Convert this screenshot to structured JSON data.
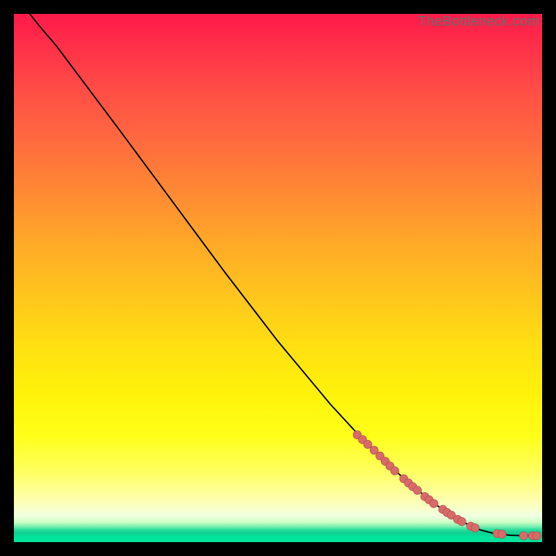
{
  "watermark": "TheBottleneck.com",
  "colors": {
    "background": "#000000",
    "dot_fill": "#d86a6a",
    "dot_stroke": "#a64646",
    "line": "#000000"
  },
  "chart_data": {
    "type": "line",
    "title": "",
    "xlabel": "",
    "ylabel": "",
    "xlim": [
      0,
      100
    ],
    "ylim": [
      0,
      100
    ],
    "note": "Axes unlabeled; values are percent of plot width/height read from pixels. y=100 at top, y=0 at bottom.",
    "line_points": [
      {
        "x": 3.0,
        "y": 100.0
      },
      {
        "x": 5.0,
        "y": 97.5
      },
      {
        "x": 8.0,
        "y": 94.0
      },
      {
        "x": 11.0,
        "y": 90.0
      },
      {
        "x": 20.0,
        "y": 78.0
      },
      {
        "x": 30.0,
        "y": 64.5
      },
      {
        "x": 40.0,
        "y": 51.0
      },
      {
        "x": 50.0,
        "y": 38.0
      },
      {
        "x": 60.0,
        "y": 26.0
      },
      {
        "x": 66.0,
        "y": 19.5
      },
      {
        "x": 70.0,
        "y": 15.5
      },
      {
        "x": 75.0,
        "y": 11.0
      },
      {
        "x": 80.0,
        "y": 7.0
      },
      {
        "x": 85.0,
        "y": 3.8
      },
      {
        "x": 88.0,
        "y": 2.4
      },
      {
        "x": 91.0,
        "y": 1.6
      },
      {
        "x": 94.0,
        "y": 1.3
      },
      {
        "x": 97.0,
        "y": 1.2
      },
      {
        "x": 99.0,
        "y": 1.2
      }
    ],
    "scatter_points": [
      {
        "x": 65.0,
        "y": 20.3,
        "r": 6
      },
      {
        "x": 66.0,
        "y": 19.4,
        "r": 6
      },
      {
        "x": 67.0,
        "y": 18.5,
        "r": 6
      },
      {
        "x": 68.2,
        "y": 17.4,
        "r": 6
      },
      {
        "x": 69.3,
        "y": 16.3,
        "r": 6
      },
      {
        "x": 70.3,
        "y": 15.3,
        "r": 6
      },
      {
        "x": 71.2,
        "y": 14.4,
        "r": 6
      },
      {
        "x": 72.1,
        "y": 13.5,
        "r": 6
      },
      {
        "x": 73.8,
        "y": 12.0,
        "r": 6
      },
      {
        "x": 74.7,
        "y": 11.2,
        "r": 6
      },
      {
        "x": 75.5,
        "y": 10.5,
        "r": 6
      },
      {
        "x": 76.4,
        "y": 9.8,
        "r": 6
      },
      {
        "x": 77.8,
        "y": 8.6,
        "r": 6
      },
      {
        "x": 78.6,
        "y": 8.0,
        "r": 6
      },
      {
        "x": 79.5,
        "y": 7.3,
        "r": 6
      },
      {
        "x": 81.2,
        "y": 6.2,
        "r": 6
      },
      {
        "x": 82.0,
        "y": 5.6,
        "r": 6
      },
      {
        "x": 82.8,
        "y": 5.1,
        "r": 6
      },
      {
        "x": 84.0,
        "y": 4.3,
        "r": 6
      },
      {
        "x": 84.8,
        "y": 3.9,
        "r": 6
      },
      {
        "x": 86.5,
        "y": 3.0,
        "r": 6
      },
      {
        "x": 87.3,
        "y": 2.7,
        "r": 6
      },
      {
        "x": 91.5,
        "y": 1.6,
        "r": 6
      },
      {
        "x": 92.4,
        "y": 1.5,
        "r": 6
      },
      {
        "x": 96.5,
        "y": 1.2,
        "r": 6
      },
      {
        "x": 98.2,
        "y": 1.2,
        "r": 6
      },
      {
        "x": 99.0,
        "y": 1.2,
        "r": 6
      }
    ]
  }
}
